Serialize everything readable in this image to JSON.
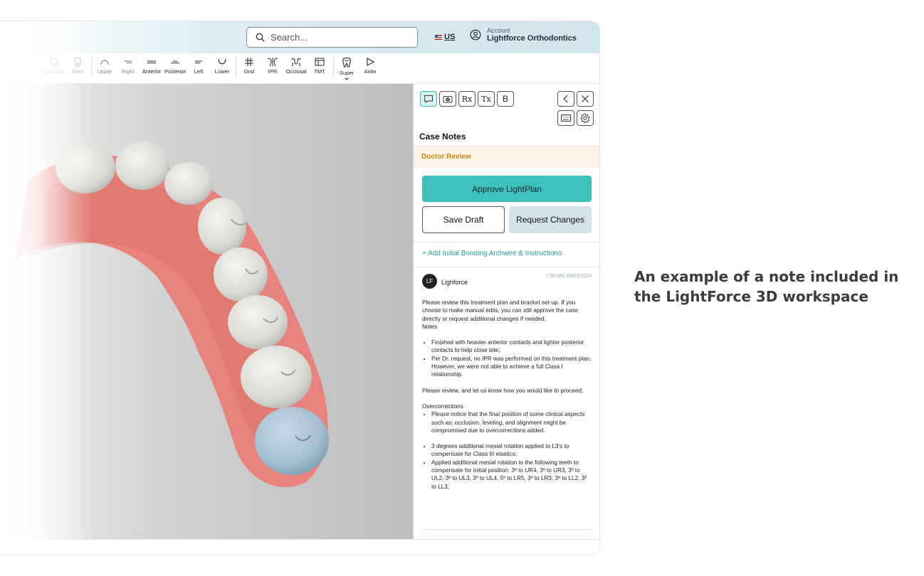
{
  "search": {
    "placeholder": "Search..."
  },
  "locale": {
    "label": "US"
  },
  "account": {
    "label": "Account",
    "name": "Lightforce Orthodontics"
  },
  "toolbar": {
    "tools": [
      {
        "label": "Original"
      },
      {
        "label": "Axes"
      },
      {
        "label": "Upper"
      },
      {
        "label": "Right"
      },
      {
        "label": "Anterior"
      },
      {
        "label": "Posterior"
      },
      {
        "label": "Left"
      },
      {
        "label": "Lower"
      },
      {
        "label": "Grid"
      },
      {
        "label": "IPR"
      },
      {
        "label": "Occlusal"
      },
      {
        "label": "TMT"
      },
      {
        "label": "Super"
      },
      {
        "label": "Anim"
      }
    ]
  },
  "panel": {
    "icon_buttons": [
      "chat-icon",
      "camera-icon",
      "rx-icon",
      "tx-icon",
      "bold-b-icon"
    ],
    "rx": "Rx",
    "tx": "Tx",
    "b": "B",
    "title": "Case Notes",
    "status": "Doctor Review",
    "approve_label": "Approve LightPlan",
    "save_label": "Save Draft",
    "request_label": "Request Changes",
    "add_link": "+ Add Initial Bonding Archwire & Instructions",
    "note": {
      "avatar_initials": "LF",
      "author": "Lighforce",
      "timestamp": "7:50 AM, 09/03/2024",
      "intro": "Please review this treatment plan and bracket set-up. If you choose to make manual edits, you can still approve the case directly or request additional changes if needed.",
      "notes_heading": "Notes",
      "bullets_1": [
        "Finished with heavier anterior contacts and lighter posterior contacts to help close bite;",
        "Per Dr. request, no IPR was performed on this treatment plan. However, we were not able to achieve a full Class I relationship."
      ],
      "review_line": "Please review, and let us know how you would like to proceed;",
      "overcorrections_heading": "Overcorrections",
      "bullets_2": [
        "Please notice that the final position of some clinical aspects such as; occlusion, leveling, and alignment might be compromised due to overcorrections added."
      ],
      "bullets_3": [
        "3 degrees additional mesial rotation applied to L3's to compensate for Class III elastics;",
        "Applied additional mesial rotation to the following teeth to compensate for initial position: 3º to UR4, 3º to UR3, 3º to UL2, 3º to UL3, 3º to UL4, 5º to LR5, 3º to LR3, 3º to LL2, 3º to LL3;"
      ]
    }
  },
  "caption": "An example of a note included in the LightForce 3D workspace",
  "colors": {
    "accent": "#3ec0bc",
    "gum": "#e8827c",
    "tooth": "#e6e6e2",
    "selected_tooth": "#a9c3d3",
    "status": "#c78a12"
  }
}
